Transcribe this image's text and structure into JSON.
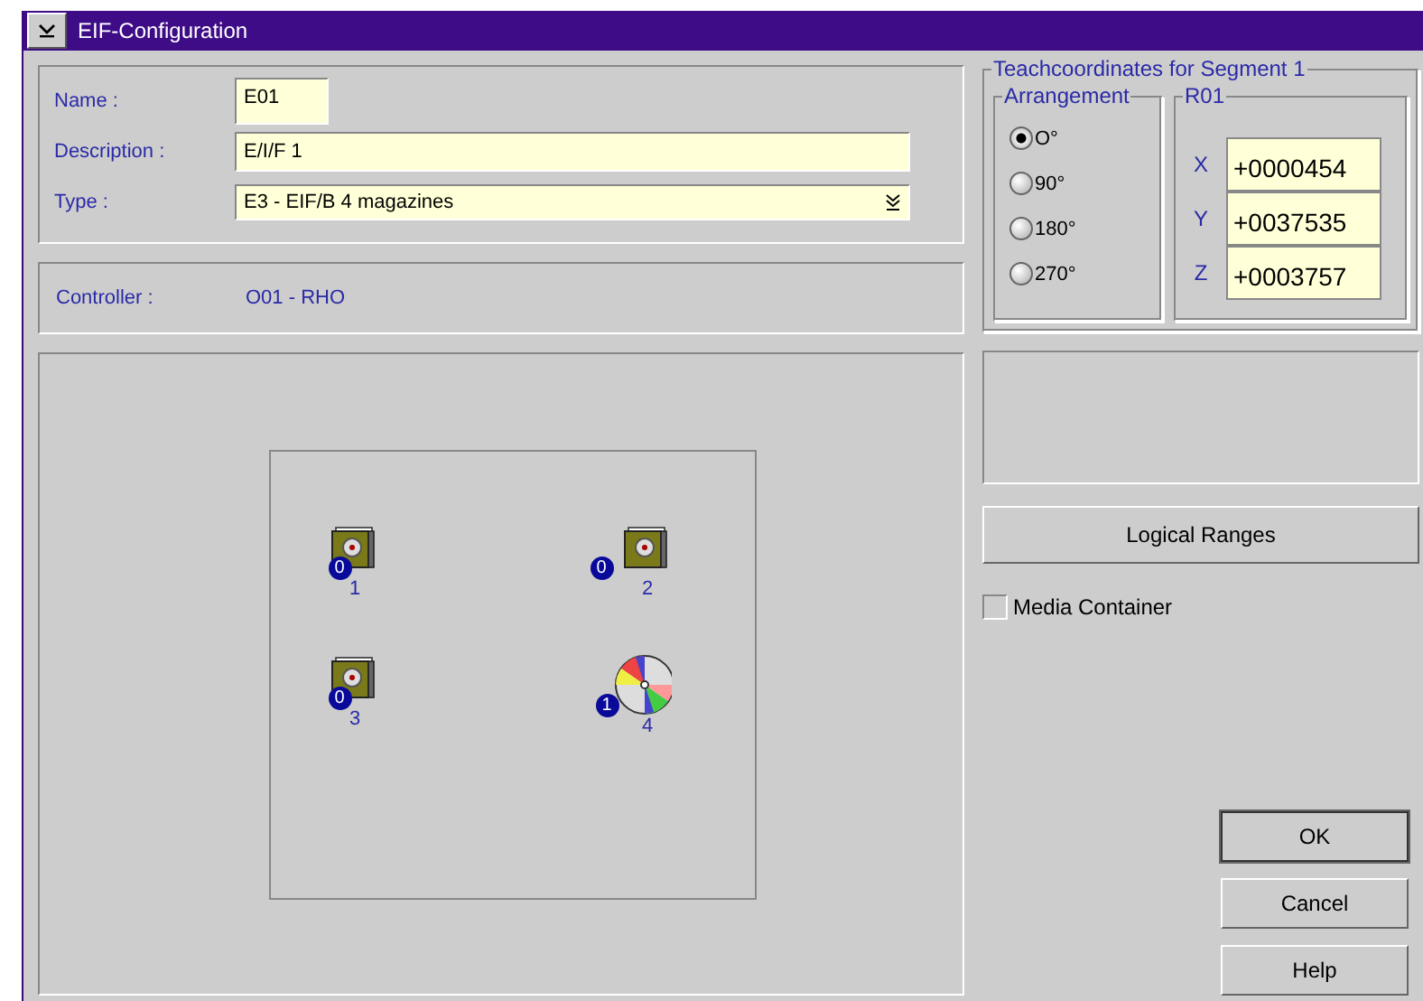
{
  "window": {
    "title": "EIF-Configuration"
  },
  "form": {
    "name_label": "Name :",
    "name": "E01",
    "description_label": "Description :",
    "description": "E/I/F 1",
    "type_label": "Type :",
    "type": "E3  -  EIF/B 4 magazines"
  },
  "controller": {
    "label": "Controller :",
    "value": "O01  -  RHO"
  },
  "magazines": [
    {
      "kind": "magazine",
      "count": "0",
      "label": "1"
    },
    {
      "kind": "magazine",
      "count": "0",
      "label": "2"
    },
    {
      "kind": "magazine",
      "count": "0",
      "label": "3"
    },
    {
      "kind": "cd",
      "count": "1",
      "label": "4"
    }
  ],
  "teach": {
    "title": "Teachcoordinates for Segment 1",
    "arrangement_title": "Arrangement",
    "arrangement": [
      {
        "label": "O°",
        "selected": true
      },
      {
        "label": "90°",
        "selected": false
      },
      {
        "label": "180°",
        "selected": false
      },
      {
        "label": "270°",
        "selected": false
      }
    ],
    "robot_title": "R01",
    "coords": [
      {
        "axis": "X",
        "value": "+0000454"
      },
      {
        "axis": "Y",
        "value": "+0037535"
      },
      {
        "axis": "Z",
        "value": "+0003757"
      }
    ]
  },
  "logical_ranges_button": "Logical Ranges",
  "media_container": {
    "label": "Media Container",
    "checked": false
  },
  "buttons": [
    "OK",
    "Cancel",
    "Help"
  ]
}
